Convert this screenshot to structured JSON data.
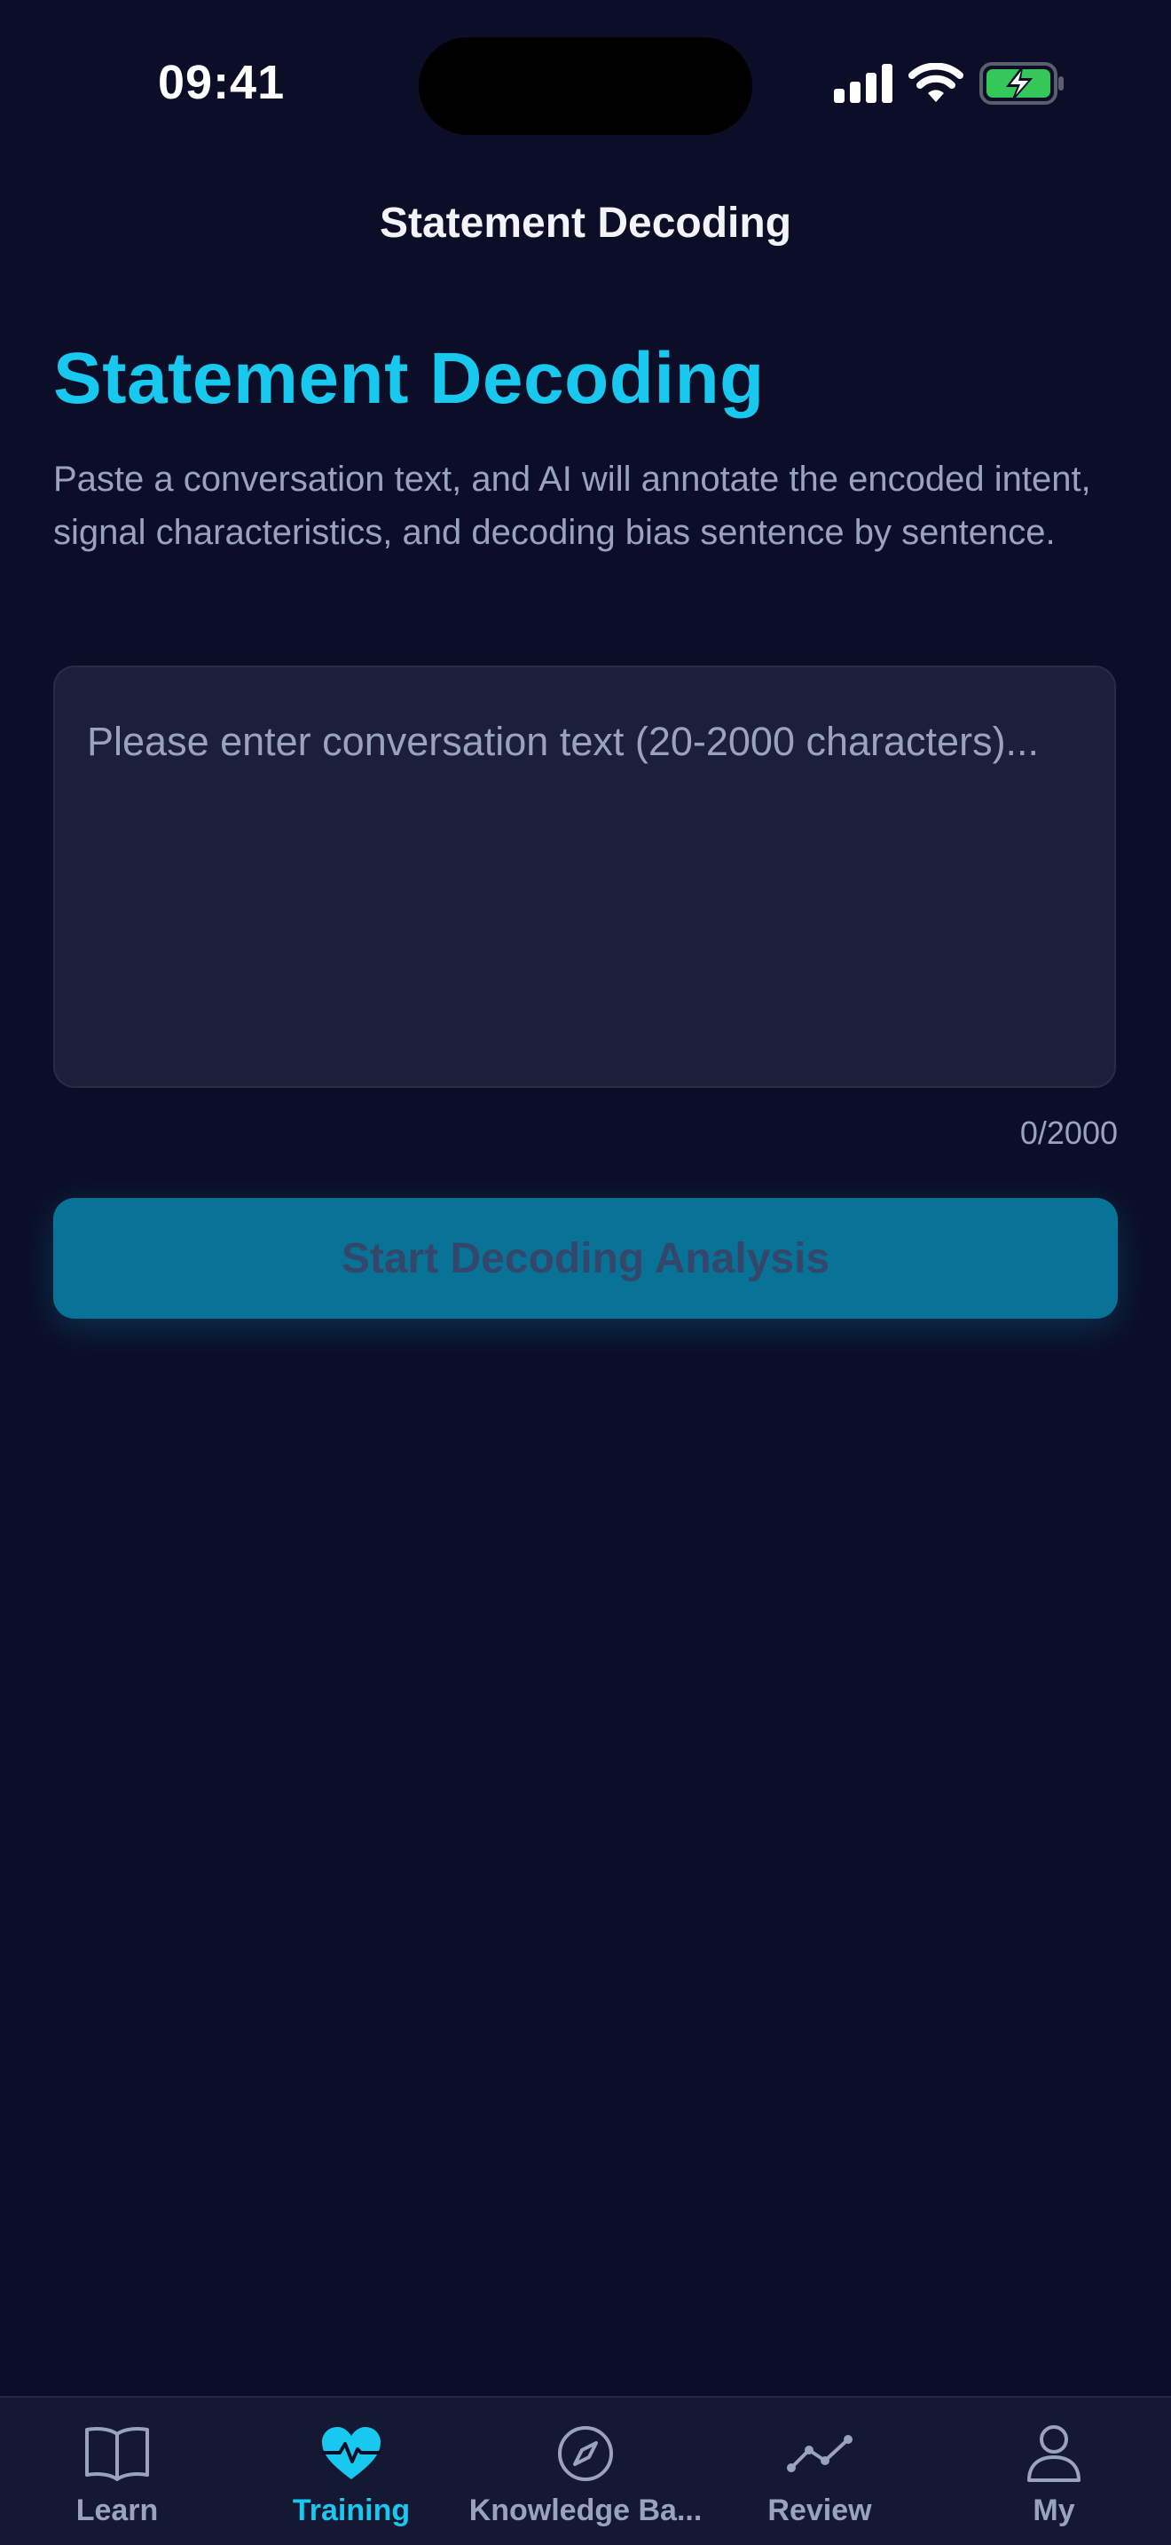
{
  "status_bar": {
    "time": "09:41"
  },
  "nav": {
    "title": "Statement Decoding"
  },
  "main": {
    "heading": "Statement Decoding",
    "description": "Paste a conversation text, and AI will annotate the encoded intent, signal characteristics, and decoding bias sentence by sentence.",
    "input": {
      "value": "",
      "placeholder": "Please enter conversation text (20-2000 characters)..."
    },
    "char_count": "0/2000",
    "start_button_label": "Start Decoding Analysis"
  },
  "tab_bar": {
    "items": [
      {
        "label": "Learn",
        "icon": "book-open-icon",
        "active": false
      },
      {
        "label": "Training",
        "icon": "heart-pulse-icon",
        "active": true
      },
      {
        "label": "Knowledge Ba...",
        "icon": "compass-icon",
        "active": false
      },
      {
        "label": "Review",
        "icon": "line-chart-icon",
        "active": false
      },
      {
        "label": "My",
        "icon": "user-icon",
        "active": false
      }
    ]
  },
  "colors": {
    "background": "#0b0e26",
    "accent": "#18c8ee",
    "button": "#087396",
    "input_bg": "#1b1f3a",
    "tab_bar_bg": "#141833",
    "muted_text": "#9aa3bd",
    "battery_green": "#34c759"
  }
}
